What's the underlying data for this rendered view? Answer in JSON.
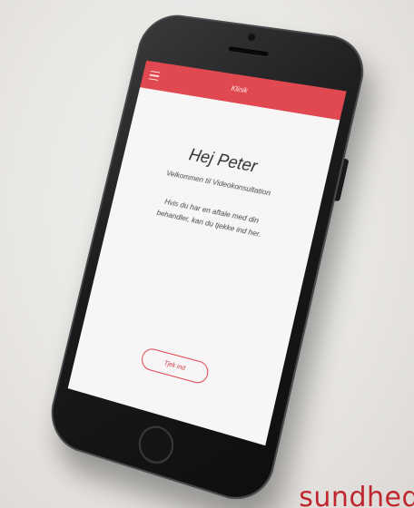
{
  "header": {
    "title": "Klinik",
    "menu_icon": "hamburger-menu-icon"
  },
  "main": {
    "greeting": "Hej Peter",
    "welcome": "Velkommen til Videokonsultation",
    "info": "Hvis du har en aftale med din behandler, kan du tjekke ind her.",
    "checkin_label": "Tjek ind"
  },
  "brand": {
    "text": "sundhed"
  },
  "colors": {
    "accent": "#e0494f",
    "screen_bg": "#f7f5f6",
    "brand": "#c0262e"
  }
}
